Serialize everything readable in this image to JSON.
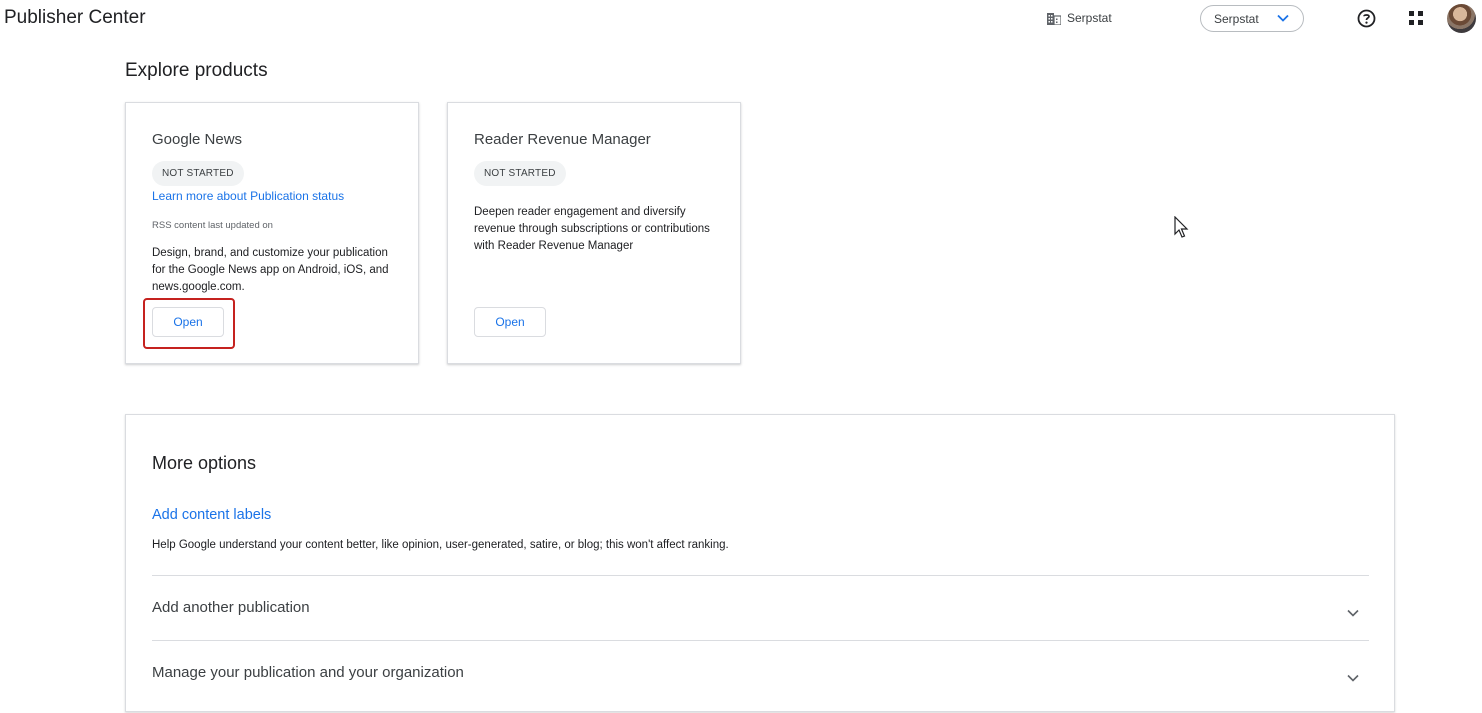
{
  "header": {
    "app_title": "Publisher Center",
    "org_name": "Serpstat",
    "org_switcher_label": "Serpstat",
    "icons": [
      "building-icon",
      "chevron-down-icon",
      "help-icon",
      "apps-grid-icon",
      "avatar"
    ]
  },
  "explore": {
    "title": "Explore products",
    "cards": [
      {
        "title": "Google News",
        "status": "NOT STARTED",
        "status_link": "Learn more about Publication status",
        "rss_note": "RSS content last updated on",
        "description": "Design, brand, and customize your publication for the Google News app on Android, iOS, and news.google.com.",
        "button": "Open"
      },
      {
        "title": "Reader Revenue Manager",
        "status": "NOT STARTED",
        "description": "Deepen reader engagement and diversify revenue through subscriptions or contributions with Reader Revenue Manager",
        "button": "Open"
      }
    ]
  },
  "more_options": {
    "title": "More options",
    "content_labels_link": "Add content labels",
    "content_labels_desc": "Help Google understand your content better, like opinion, user-generated, satire, or blog; this won't affect ranking.",
    "rows": [
      {
        "label": "Add another publication"
      },
      {
        "label": "Manage your publication and your organization"
      }
    ]
  },
  "colors": {
    "link": "#1a73e8",
    "highlight": "#c5221f",
    "border": "#dadce0",
    "badge_bg": "#f1f3f4"
  }
}
